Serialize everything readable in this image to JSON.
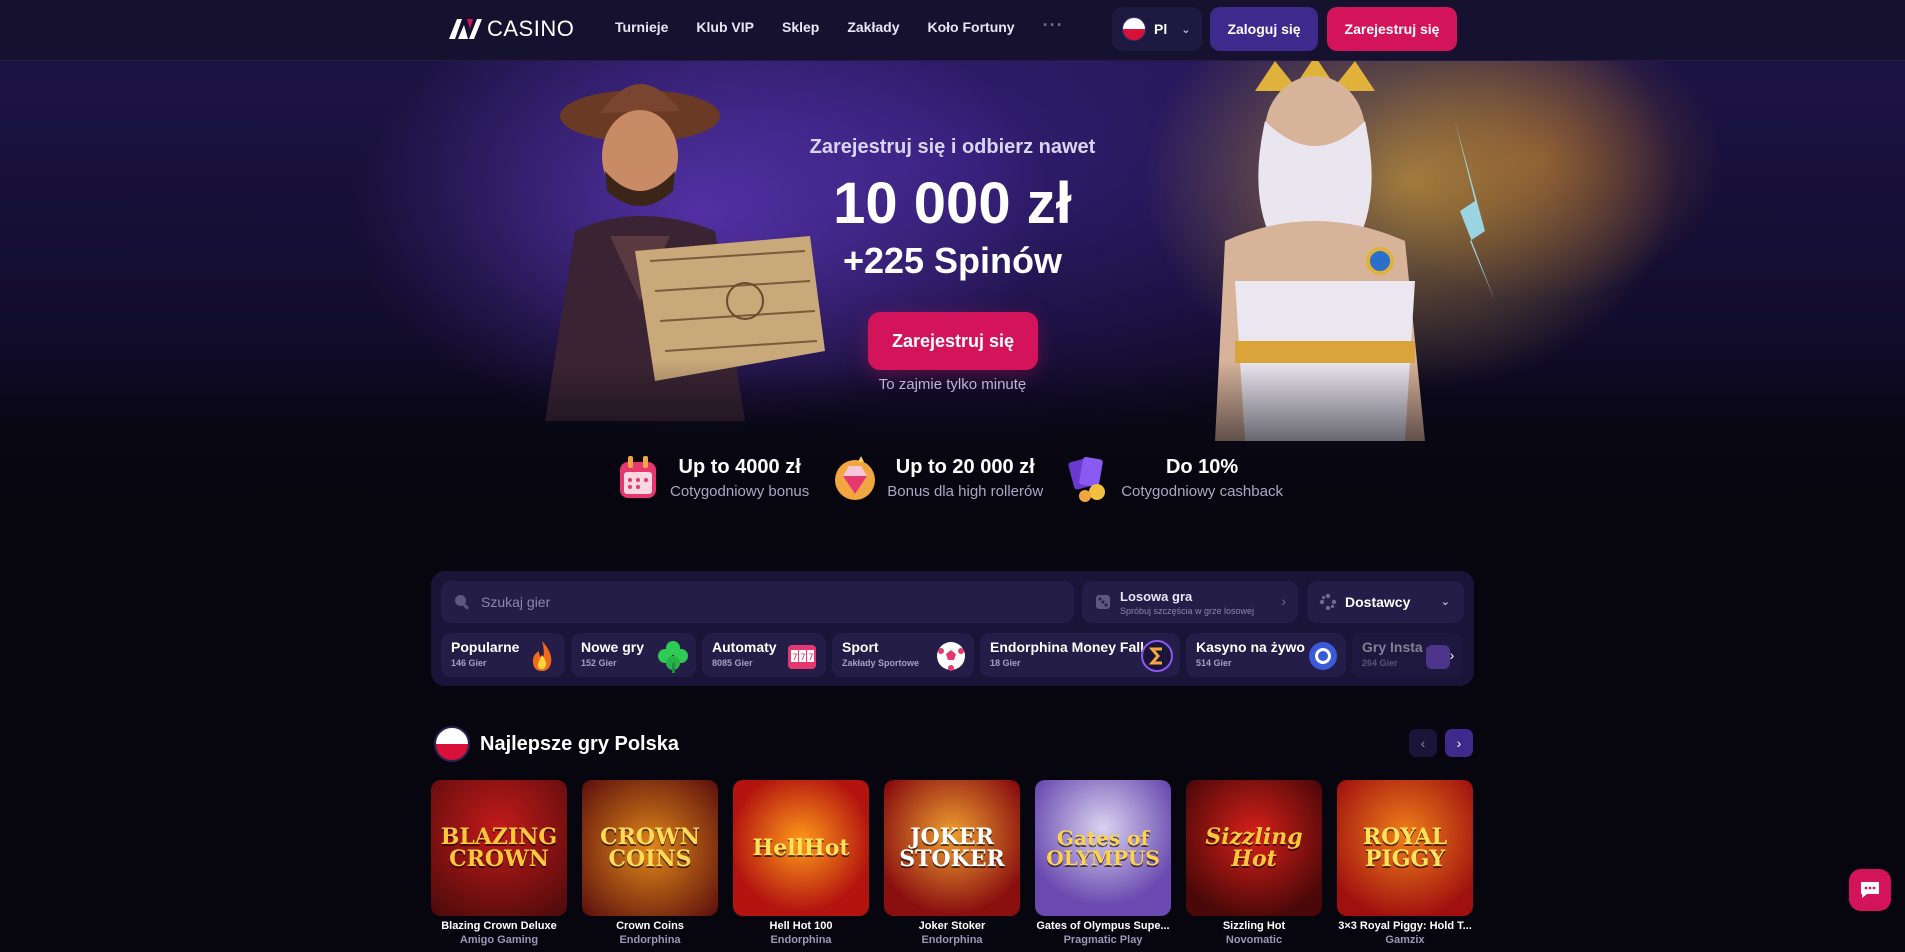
{
  "header": {
    "logo_text": "CASINO",
    "nav": [
      "Turnieje",
      "Klub VIP",
      "Sklep",
      "Zakłady",
      "Koło Fortuny"
    ],
    "more": "···",
    "lang": "Pl",
    "login": "Zaloguj się",
    "register": "Zarejestruj się"
  },
  "hero": {
    "subtitle": "Zarejestruj się i odbierz nawet",
    "amount": "10 000 zł",
    "spins": "+225 Spinów",
    "cta": "Zarejestruj się",
    "note": "To zajmie tylko minutę"
  },
  "perks": [
    {
      "title": "Up to 4000 zł",
      "sub": "Cotygodniowy bonus",
      "icon": "calendar-gift-icon"
    },
    {
      "title": "Up to 20 000 zł",
      "sub": "Bonus dla high rollerów",
      "icon": "diamond-icon"
    },
    {
      "title": "Do 10%",
      "sub": "Cotygodniowy cashback",
      "icon": "cards-coins-icon"
    }
  ],
  "search": {
    "placeholder": "Szukaj gier"
  },
  "random": {
    "title": "Losowa gra",
    "sub": "Spróbuj szczęścia w grze losowej"
  },
  "providers": {
    "label": "Dostawcy"
  },
  "categories": [
    {
      "name": "Popularne",
      "count": "146 Gier",
      "icon": "fire-icon"
    },
    {
      "name": "Nowe gry",
      "count": "152 Gier",
      "icon": "clover-icon"
    },
    {
      "name": "Automaty",
      "count": "8085 Gier",
      "icon": "slot-machine-icon"
    },
    {
      "name": "Sport",
      "count": "Zakłady Sportowe",
      "icon": "football-icon"
    },
    {
      "name": "Endorphina Money Fall",
      "count": "18 Gier",
      "icon": "endorphina-icon"
    },
    {
      "name": "Kasyno na żywo",
      "count": "514 Gier",
      "icon": "poker-chip-icon"
    },
    {
      "name": "Gry Insta",
      "count": "264 Gier",
      "icon": "instant-icon"
    }
  ],
  "section": {
    "title": "Najlepsze gry Polska"
  },
  "games": [
    {
      "name": "Blazing Crown Deluxe",
      "provider": "Amigo Gaming",
      "art": "BLAZING CROWN"
    },
    {
      "name": "Crown Coins",
      "provider": "Endorphina",
      "art": "CROWN COINS"
    },
    {
      "name": "Hell Hot 100",
      "provider": "Endorphina",
      "art": "HellHot"
    },
    {
      "name": "Joker Stoker",
      "provider": "Endorphina",
      "art": "JOKER STOKER"
    },
    {
      "name": "Gates of Olympus Supe...",
      "provider": "Pragmatic Play",
      "art": "Gates of OLYMPUS"
    },
    {
      "name": "Sizzling Hot",
      "provider": "Novomatic",
      "art": "Sizzling Hot"
    },
    {
      "name": "3×3 Royal Piggy: Hold T...",
      "provider": "Gamzix",
      "art": "ROYAL PIGGY"
    }
  ],
  "colors": {
    "accent": "#d4145a",
    "purple": "#3e2a8c",
    "panel": "#1a1538",
    "bg": "#07060f"
  }
}
